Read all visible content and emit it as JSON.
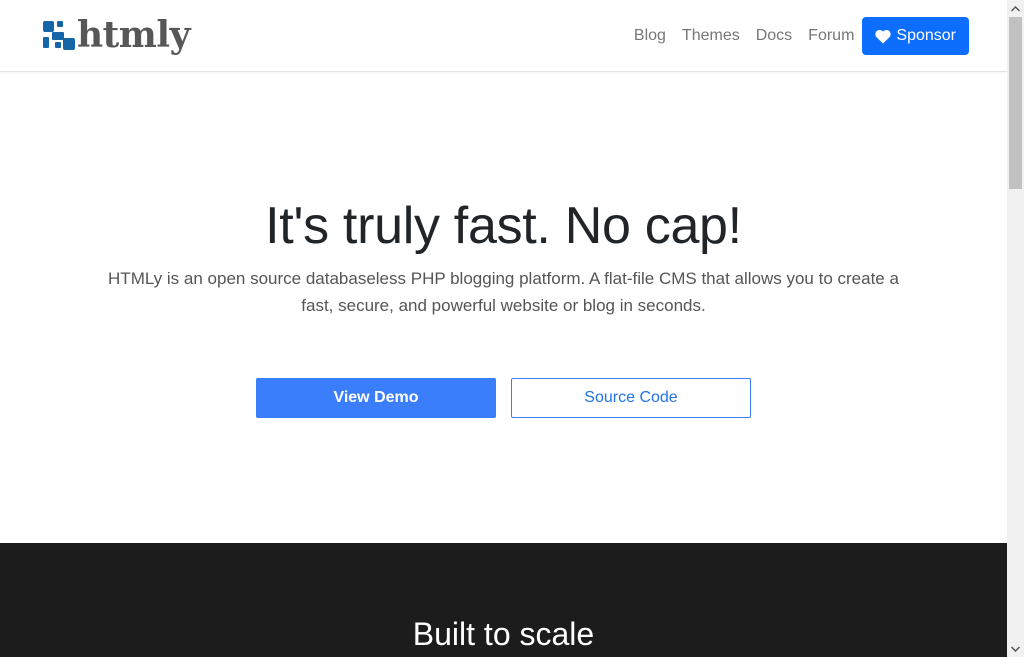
{
  "brand": {
    "name": "htmly",
    "logo_icon": "htmly-logo-icon"
  },
  "nav": {
    "links": [
      "Blog",
      "Themes",
      "Docs",
      "Forum"
    ],
    "sponsor_label": "Sponsor",
    "sponsor_icon": "heart-icon"
  },
  "hero": {
    "title": "It's truly fast. No cap!",
    "subtitle": "HTMLy is an open source databaseless PHP blogging platform. A flat-file CMS that allows you to create a fast, secure, and powerful website or blog in seconds.",
    "primary_button": "View Demo",
    "secondary_button": "Source Code"
  },
  "section": {
    "title": "Built to scale"
  },
  "colors": {
    "primary": "#3a7efc",
    "sponsor": "#0d6efd",
    "dark_bg": "#1c1c1c",
    "logo_blue": "#1565a8"
  }
}
